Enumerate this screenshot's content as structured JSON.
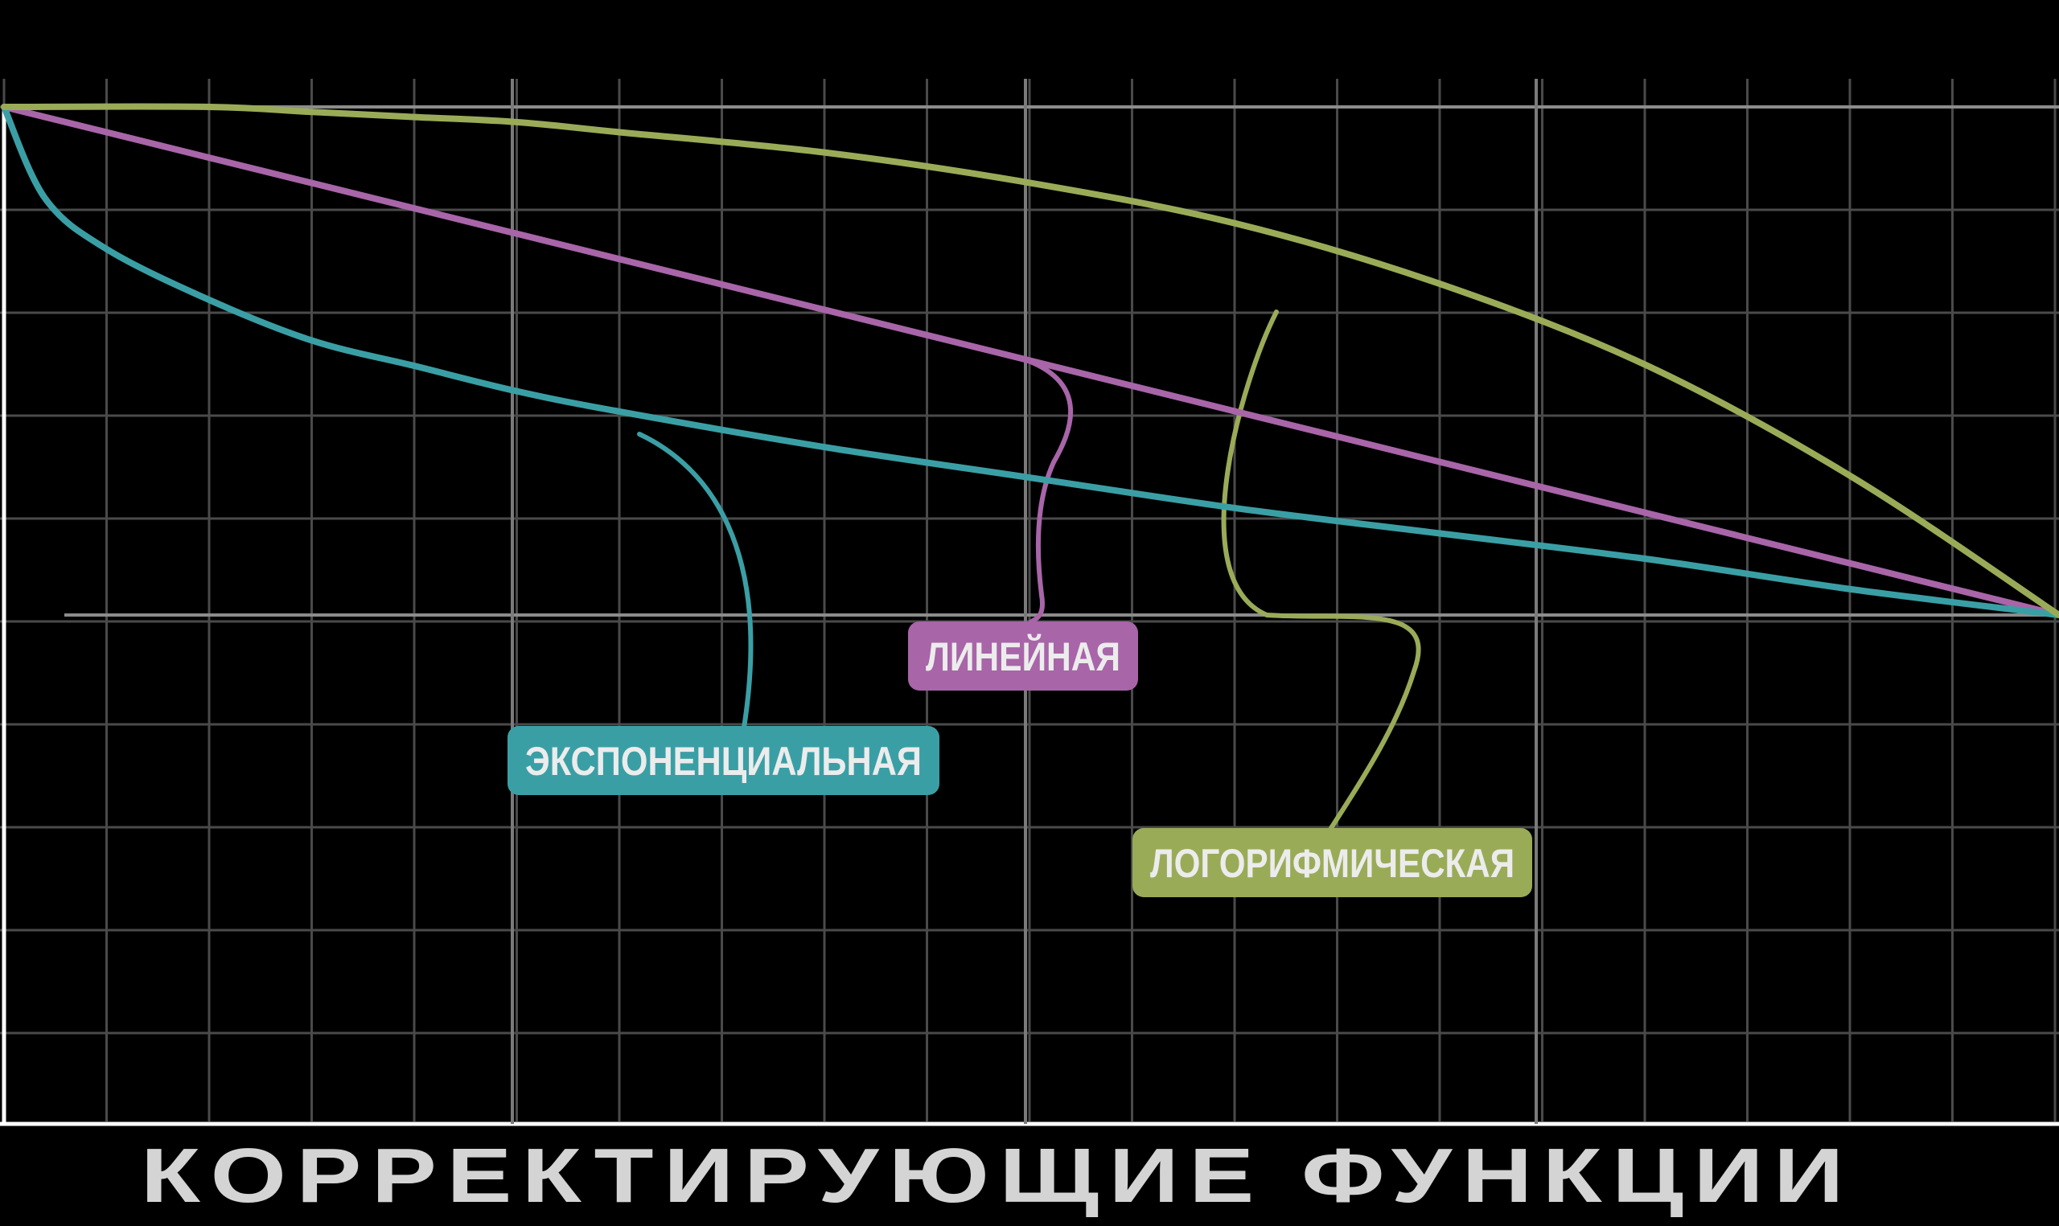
{
  "chart_data": {
    "type": "line",
    "title": "КОРРЕКТИРУЮЩИЕ ФУНКЦИИ",
    "xlabel": "",
    "ylabel": "",
    "xlim": [
      0,
      1
    ],
    "ylim": [
      0,
      1
    ],
    "grid": true,
    "legend": "callout labels",
    "series": [
      {
        "name": "ЛИНЕЙНАЯ",
        "color": "#a865a8",
        "x": [
          0.0,
          0.1,
          0.2,
          0.3,
          0.4,
          0.5,
          0.6,
          0.7,
          0.8,
          0.9,
          1.0
        ],
        "y": [
          1.0,
          0.9,
          0.8,
          0.7,
          0.6,
          0.5,
          0.4,
          0.3,
          0.2,
          0.1,
          0.0
        ]
      },
      {
        "name": "ЭКСПОНЕНЦИАЛЬНАЯ",
        "color": "#3a9fa5",
        "x": [
          0.0,
          0.02,
          0.05,
          0.1,
          0.15,
          0.2,
          0.25,
          0.3,
          0.4,
          0.5,
          0.6,
          0.7,
          0.8,
          0.9,
          1.0
        ],
        "y": [
          1.0,
          0.82,
          0.72,
          0.62,
          0.54,
          0.49,
          0.44,
          0.4,
          0.33,
          0.27,
          0.21,
          0.16,
          0.11,
          0.05,
          0.0
        ]
      },
      {
        "name": "ЛОГОРИФМИЧЕСКАЯ",
        "color": "#9aab58",
        "x": [
          0.0,
          0.1,
          0.15,
          0.2,
          0.25,
          0.3,
          0.4,
          0.5,
          0.6,
          0.7,
          0.8,
          0.9,
          1.0
        ],
        "y": [
          1.0,
          1.0,
          0.99,
          0.98,
          0.97,
          0.95,
          0.91,
          0.85,
          0.77,
          0.65,
          0.49,
          0.27,
          0.0
        ]
      }
    ]
  }
}
